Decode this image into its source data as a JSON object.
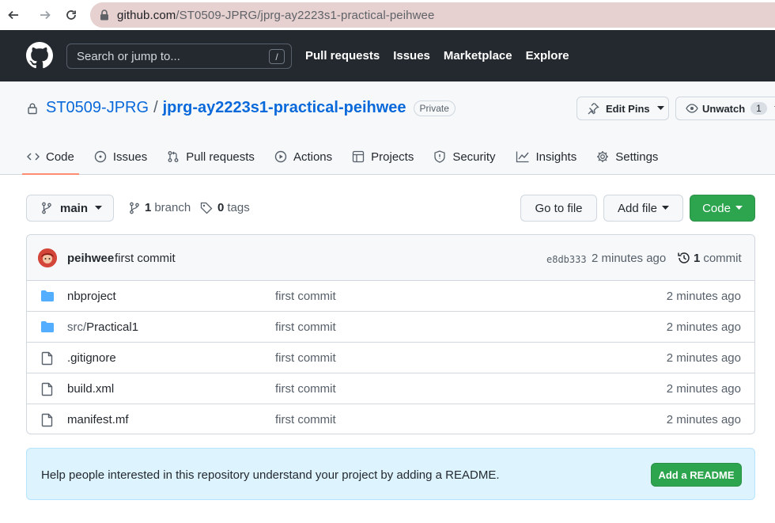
{
  "browser": {
    "url_host": "github.com",
    "url_path": "/ST0509-JPRG/jprg-ay2223s1-practical-peihwee"
  },
  "header": {
    "search_placeholder": "Search or jump to...",
    "slash_key": "/",
    "nav": [
      "Pull requests",
      "Issues",
      "Marketplace",
      "Explore"
    ]
  },
  "repo": {
    "owner": "ST0509-JPRG",
    "separator": "/",
    "name": "jprg-ay2223s1-practical-peihwee",
    "visibility": "Private",
    "edit_pins_label": "Edit Pins",
    "watch_label": "Unwatch",
    "watch_count": "1"
  },
  "tabs": [
    {
      "label": "Code",
      "icon": "code-icon",
      "active": true
    },
    {
      "label": "Issues",
      "icon": "issue-icon"
    },
    {
      "label": "Pull requests",
      "icon": "pull-request-icon"
    },
    {
      "label": "Actions",
      "icon": "play-icon"
    },
    {
      "label": "Projects",
      "icon": "table-icon"
    },
    {
      "label": "Security",
      "icon": "shield-icon"
    },
    {
      "label": "Insights",
      "icon": "graph-icon"
    },
    {
      "label": "Settings",
      "icon": "gear-icon"
    }
  ],
  "toolbar": {
    "branch": "main",
    "branch_count": "1",
    "branch_label": "branch",
    "tag_count": "0",
    "tag_label": "tags",
    "go_to_file": "Go to file",
    "add_file": "Add file",
    "code": "Code"
  },
  "latest_commit": {
    "author": "peihwee",
    "message": "first commit",
    "sha": "e8db333",
    "time": "2 minutes ago",
    "count": "1",
    "count_label": "commit"
  },
  "files": [
    {
      "dir": "",
      "name": "nbproject",
      "type": "folder",
      "message": "first commit",
      "time": "2 minutes ago"
    },
    {
      "dir": "src/",
      "name": "Practical1",
      "type": "folder",
      "message": "first commit",
      "time": "2 minutes ago"
    },
    {
      "dir": "",
      "name": ".gitignore",
      "type": "file",
      "message": "first commit",
      "time": "2 minutes ago"
    },
    {
      "dir": "",
      "name": "build.xml",
      "type": "file",
      "message": "first commit",
      "time": "2 minutes ago"
    },
    {
      "dir": "",
      "name": "manifest.mf",
      "type": "file",
      "message": "first commit",
      "time": "2 minutes ago"
    }
  ],
  "readme_banner": {
    "text": "Help people interested in this repository understand your project by adding a README.",
    "button": "Add a README"
  },
  "colors": {
    "header_bg": "#24292f",
    "link_blue": "#0969da",
    "green": "#2da44e",
    "folder_blue": "#54aeff",
    "banner_bg": "#ddf4ff"
  }
}
